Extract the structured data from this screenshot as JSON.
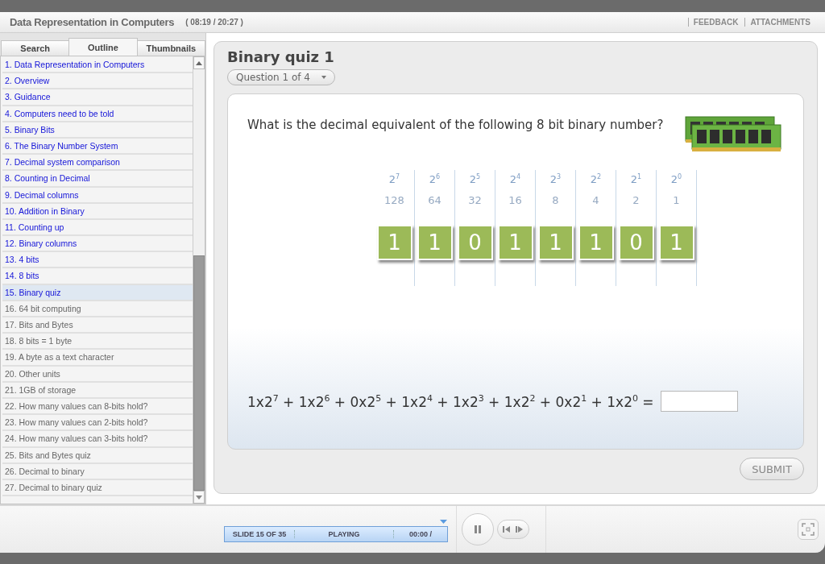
{
  "header": {
    "title": "Data Representation in Computers",
    "time": "( 08:19 / 20:27 )",
    "links": [
      "FEEDBACK",
      "ATTACHMENTS"
    ]
  },
  "sidebar": {
    "tabs": [
      {
        "label": "Search",
        "selected": false
      },
      {
        "label": "Outline",
        "selected": true
      },
      {
        "label": "Thumbnails",
        "selected": false
      }
    ],
    "items": [
      {
        "label": "1. Data Representation in Computers",
        "visited": true,
        "selected": false
      },
      {
        "label": "2. Overview",
        "visited": true,
        "selected": false
      },
      {
        "label": "3. Guidance",
        "visited": true,
        "selected": false
      },
      {
        "label": "4. Computers need to be told",
        "visited": true,
        "selected": false
      },
      {
        "label": "5. Binary Bits",
        "visited": true,
        "selected": false
      },
      {
        "label": "6. The Binary Number System",
        "visited": true,
        "selected": false
      },
      {
        "label": "7. Decimal system comparison",
        "visited": true,
        "selected": false
      },
      {
        "label": "8. Counting in Decimal",
        "visited": true,
        "selected": false
      },
      {
        "label": "9. Decimal columns",
        "visited": true,
        "selected": false
      },
      {
        "label": "10. Addition in Binary",
        "visited": true,
        "selected": false
      },
      {
        "label": "11. Counting up",
        "visited": true,
        "selected": false
      },
      {
        "label": "12. Binary columns",
        "visited": true,
        "selected": false
      },
      {
        "label": "13. 4 bits",
        "visited": true,
        "selected": false
      },
      {
        "label": "14. 8 bits",
        "visited": true,
        "selected": false
      },
      {
        "label": "15. Binary quiz",
        "visited": true,
        "selected": true
      },
      {
        "label": "16. 64 bit computing",
        "visited": false,
        "selected": false
      },
      {
        "label": "17. Bits and Bytes",
        "visited": false,
        "selected": false
      },
      {
        "label": "18. 8 bits = 1 byte",
        "visited": false,
        "selected": false
      },
      {
        "label": "19. A byte as a text character",
        "visited": false,
        "selected": false
      },
      {
        "label": "20. Other units",
        "visited": false,
        "selected": false
      },
      {
        "label": "21. 1GB of storage",
        "visited": false,
        "selected": false
      },
      {
        "label": "22. How many values can 8-bits hold?",
        "visited": false,
        "selected": false
      },
      {
        "label": "23. How many values can 2-bits hold?",
        "visited": false,
        "selected": false
      },
      {
        "label": "24. How many values can 3-bits hold?",
        "visited": false,
        "selected": false
      },
      {
        "label": "25. Bits and Bytes quiz",
        "visited": false,
        "selected": false
      },
      {
        "label": "26. Decimal to binary",
        "visited": false,
        "selected": false
      },
      {
        "label": "27. Decimal to binary quiz",
        "visited": false,
        "selected": false
      }
    ]
  },
  "slide": {
    "title": "Binary quiz 1",
    "question_selector": "Question 1 of 4",
    "question": "What is the decimal equivalent of the following 8 bit binary number?",
    "columns": [
      {
        "power": "2$^{7}$",
        "value": "128",
        "bit": "1"
      },
      {
        "power": "2$^{6}$",
        "value": "64",
        "bit": "1"
      },
      {
        "power": "2$^{5}$",
        "value": "32",
        "bit": "0"
      },
      {
        "power": "2$^{4}$",
        "value": "16",
        "bit": "1"
      },
      {
        "power": "2$^{3}$",
        "value": "8",
        "bit": "1"
      },
      {
        "power": "2$^{2}$",
        "value": "4",
        "bit": "1"
      },
      {
        "power": "2$^{1}$",
        "value": "2",
        "bit": "0"
      },
      {
        "power": "2$^{0}$",
        "value": "1",
        "bit": "1"
      }
    ],
    "equation": "1x2$^{7}$ + 1x2$^{6}$ + 0x2$^{5}$ + 1x2$^{4}$ + 1x2$^{3}$ + 1x2$^{2}$ + 0x2$^{1}$ + 1x2$^{0}$ =",
    "submit": "SUBMIT"
  },
  "player": {
    "slide_counter": "SLIDE 15 OF 35",
    "status": "PLAYING",
    "elapsed": "00:00 /"
  }
}
